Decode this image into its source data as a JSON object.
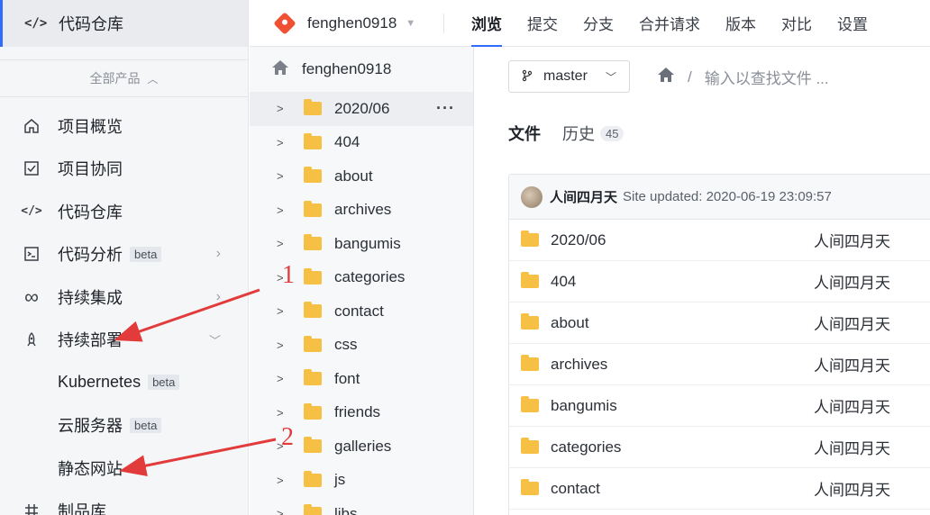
{
  "sidebar": {
    "top": {
      "label": "代码仓库",
      "icon": "code-icon"
    },
    "products_label": "全部产品",
    "items": [
      {
        "label": "项目概览",
        "icon": "home-icon"
      },
      {
        "label": "项目协同",
        "icon": "checkbox-icon"
      },
      {
        "label": "代码仓库",
        "icon": "code-icon"
      },
      {
        "label": "代码分析",
        "icon": "terminal-icon",
        "badge": "beta"
      },
      {
        "label": "持续集成",
        "icon": "infinity-icon"
      },
      {
        "label": "持续部署",
        "icon": "rocket-icon"
      },
      {
        "label": "Kubernetes",
        "badge": "beta"
      },
      {
        "label": "云服务器",
        "badge": "beta"
      },
      {
        "label": "静态网站"
      },
      {
        "label": "制品库",
        "icon": "grid-icon"
      }
    ]
  },
  "topbar": {
    "repo": "fenghen0918",
    "tabs": [
      "浏览",
      "提交",
      "分支",
      "合并请求",
      "版本",
      "对比",
      "设置"
    ]
  },
  "tree": {
    "root": "fenghen0918",
    "items": [
      "2020/06",
      "404",
      "about",
      "archives",
      "bangumis",
      "categories",
      "contact",
      "css",
      "font",
      "friends",
      "galleries",
      "js",
      "libs"
    ]
  },
  "main": {
    "branch": "master",
    "search_placeholder": "输入以查找文件 ...",
    "tabs": {
      "files": "文件",
      "history": "历史",
      "history_count": "45"
    },
    "commit": {
      "author": "人间四月天",
      "message": "Site updated: 2020-06-19 23:09:57"
    },
    "files": [
      {
        "name": "2020/06",
        "author": "人间四月天"
      },
      {
        "name": "404",
        "author": "人间四月天"
      },
      {
        "name": "about",
        "author": "人间四月天"
      },
      {
        "name": "archives",
        "author": "人间四月天"
      },
      {
        "name": "bangumis",
        "author": "人间四月天"
      },
      {
        "name": "categories",
        "author": "人间四月天"
      },
      {
        "name": "contact",
        "author": "人间四月天"
      }
    ]
  },
  "annotations": {
    "one": "1",
    "two": "2",
    "color": "#e23b3b"
  },
  "colors": {
    "accent": "#2f6bff",
    "folder": "#f5c044",
    "git": "#f05133"
  }
}
